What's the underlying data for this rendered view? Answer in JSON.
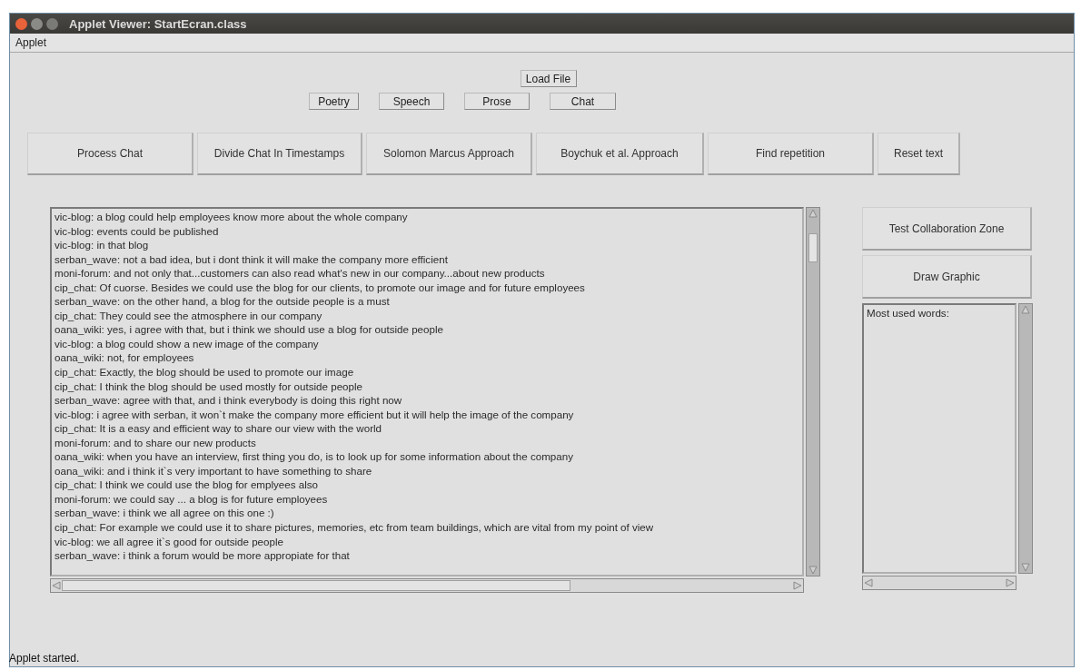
{
  "window": {
    "title": "Applet Viewer: StartEcran.class"
  },
  "menu": [
    "Applet"
  ],
  "load_button": "Load File",
  "genre_buttons": [
    "Poetry",
    "Speech",
    "Prose",
    "Chat"
  ],
  "action_buttons": [
    "Process Chat",
    "Divide Chat In Timestamps",
    "Solomon Marcus Approach",
    "Boychuk et al. Approach",
    "Find repetition",
    "Reset text"
  ],
  "chat_lines": [
    "vic-blog: a blog could help employees know more about the whole company",
    "vic-blog: events could be published",
    "vic-blog: in that blog",
    "serban_wave: not a bad idea, but i dont think it will make the company more efficient",
    "moni-forum: and not only that...customers can also read what's new in our company...about new products",
    "cip_chat: Of cuorse. Besides we could use the blog for our clients, to promote our image and for future employees",
    "serban_wave: on the other hand, a blog for the outside people is a must",
    "cip_chat: They could see the atmosphere in our company",
    "oana_wiki: yes, i agree with that, but i think we should use a blog for outside people",
    "vic-blog: a blog could show a new image of the company",
    "oana_wiki: not, for employees",
    "cip_chat: Exactly, the blog should be used to promote our image",
    "cip_chat: I think the blog should be used mostly for outside people",
    "serban_wave: agree with that, and i think everybody is doing this right now",
    "vic-blog: i agree with serban, it won`t make the company more efficient but it will help the image of the company",
    "cip_chat: It is a easy and efficient way to share our view with the world",
    "moni-forum: and to share our new products",
    "oana_wiki: when you have an interview, first thing you do, is to look up for some information about the company",
    "oana_wiki: and i think it`s very important to have something to share",
    "cip_chat: I think we could use the blog for emplyees also",
    "moni-forum: we could say ... a blog is for future employees",
    "serban_wave: i think we all agree on this one :)",
    "cip_chat: For example we could use it to share pictures, memories, etc from team buildings, which are vital from my point of view",
    "vic-blog: we all agree it`s good for outside people",
    "serban_wave: i think a forum would be more appropiate for that"
  ],
  "side_buttons": [
    "Test Collaboration Zone",
    "Draw Graphic"
  ],
  "words_area": {
    "text": "Most used words:"
  },
  "status_bar": "Applet started."
}
